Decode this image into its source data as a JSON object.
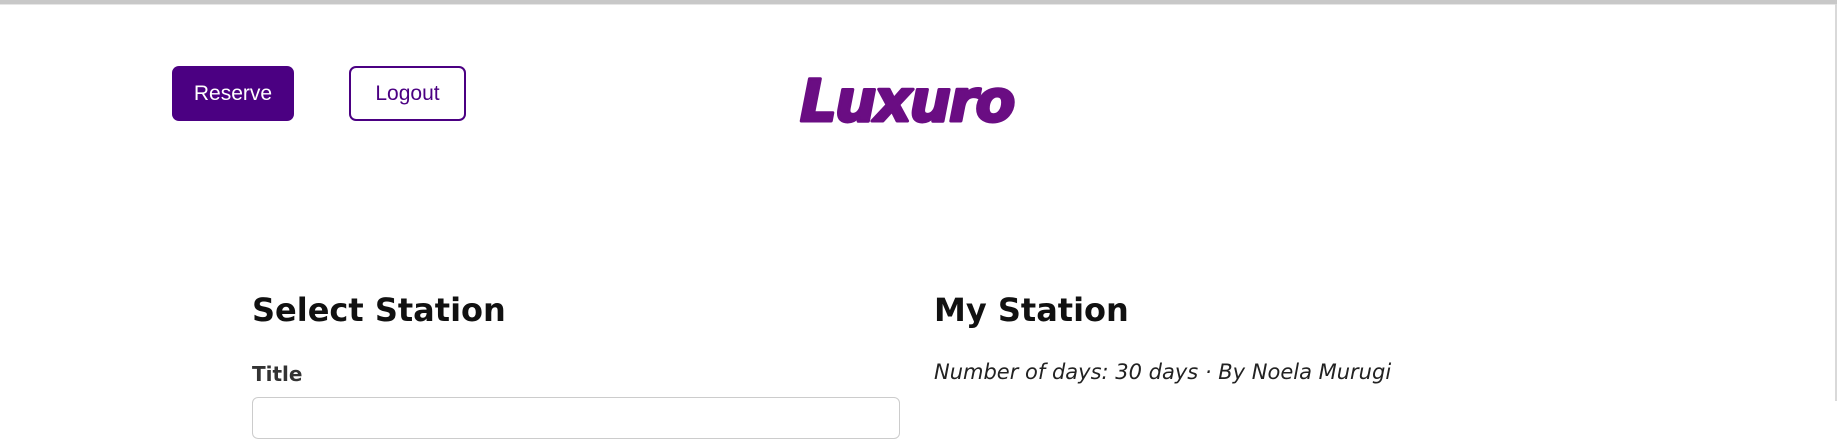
{
  "header": {
    "reserve_label": "Reserve",
    "logout_label": "Logout",
    "logo_text": "Luxuro",
    "brand_color": "#4b0082",
    "logo_color": "#6a0d83"
  },
  "left_panel": {
    "title": "Select Station",
    "field_label": "Title"
  },
  "right_panel": {
    "title": "My Station",
    "meta_text": "Number of days: 30 days · By Noela Murugi"
  }
}
